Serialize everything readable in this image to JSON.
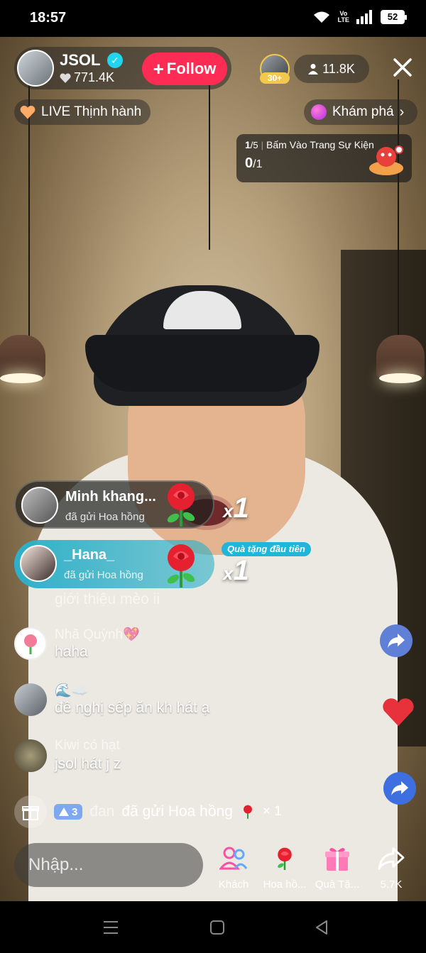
{
  "status_bar": {
    "time": "18:57",
    "network": "Vo\nLTE",
    "battery": "52"
  },
  "host": {
    "name": "JSOL",
    "likes": "771.4K",
    "follow_label": "Follow"
  },
  "viewers": {
    "rank_badge": "30+",
    "count": "11.8K"
  },
  "chips": {
    "trending": "LIVE Thịnh hành",
    "explore": "Khám phá"
  },
  "event": {
    "step": "1",
    "step_total": "/5",
    "label": "Bấm Vào Trang Sự Kiện",
    "progress": "0",
    "progress_total": "/1"
  },
  "gifts": [
    {
      "user": "Minh khang...",
      "action": "đã gửi Hoa hồng",
      "count": "1",
      "times": "x"
    },
    {
      "user": "_Hana_",
      "action": "đã gửi Hoa hồng",
      "count": "1",
      "times": "x",
      "badge": "Quà tặng đầu tiên"
    }
  ],
  "faded_comment": "giới thiệu mèo ii",
  "comments": [
    {
      "user": "Nhã Quỳnh💖",
      "text": "haha"
    },
    {
      "user": "🌊☁️",
      "text": "đề nghị sếp ăn kh hát ạ"
    },
    {
      "user": "Kiwi có hạt",
      "text": "jsol hát j z"
    }
  ],
  "gift_notice": {
    "level": "3",
    "user": "đan",
    "text": "đã gửi Hoa hồng",
    "times": "× 1"
  },
  "bottom": {
    "input_placeholder": "Nhập...",
    "actions": [
      {
        "label": "Khách"
      },
      {
        "label": "Hoa hồ..."
      },
      {
        "label": "Quà Tặ..."
      },
      {
        "label": "5.7K"
      }
    ]
  },
  "icons": {
    "verified": "verified-check-icon",
    "heart": "heart-icon",
    "person": "person-icon",
    "close": "close-icon",
    "gift": "gift-box-icon",
    "share": "share-arrow-icon",
    "rose": "rose-icon"
  },
  "colors": {
    "follow": "#fe2c55",
    "verified": "#20d5ec",
    "toast_teal": "#2fb0c8",
    "like_heart": "#e8323b"
  }
}
